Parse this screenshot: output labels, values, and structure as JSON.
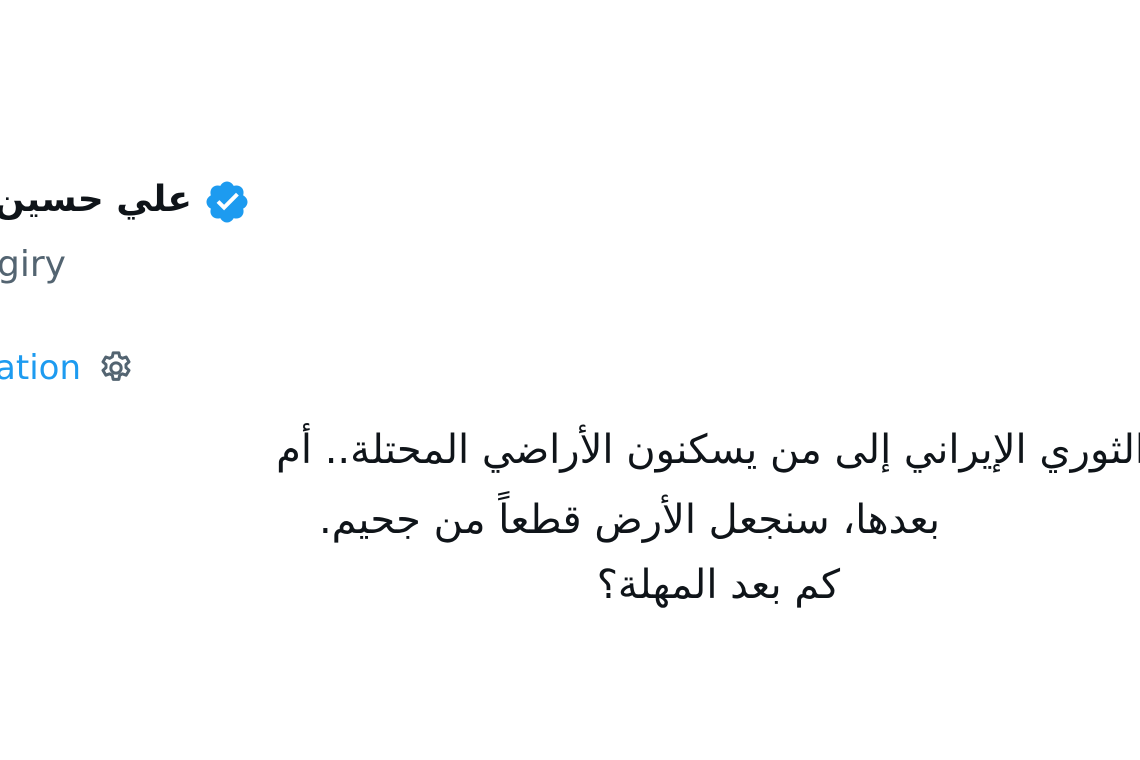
{
  "tweet": {
    "author": {
      "display_name": "علي حسين",
      "handle": "giry",
      "verified": true
    },
    "translate_label": "ation",
    "body_lines": [
      "الثوري الإيراني إلى من يسكنون الأراضي المحتلة.. أم",
      "بعدها، سنجعل الأرض قطعاً من جحيم.",
      "كم بعد المهلة؟"
    ]
  },
  "icons": {
    "verified": "verified-badge-icon",
    "settings": "gear-icon"
  },
  "colors": {
    "text_primary": "#0f1419",
    "text_secondary": "#536471",
    "accent": "#1d9bf0"
  }
}
